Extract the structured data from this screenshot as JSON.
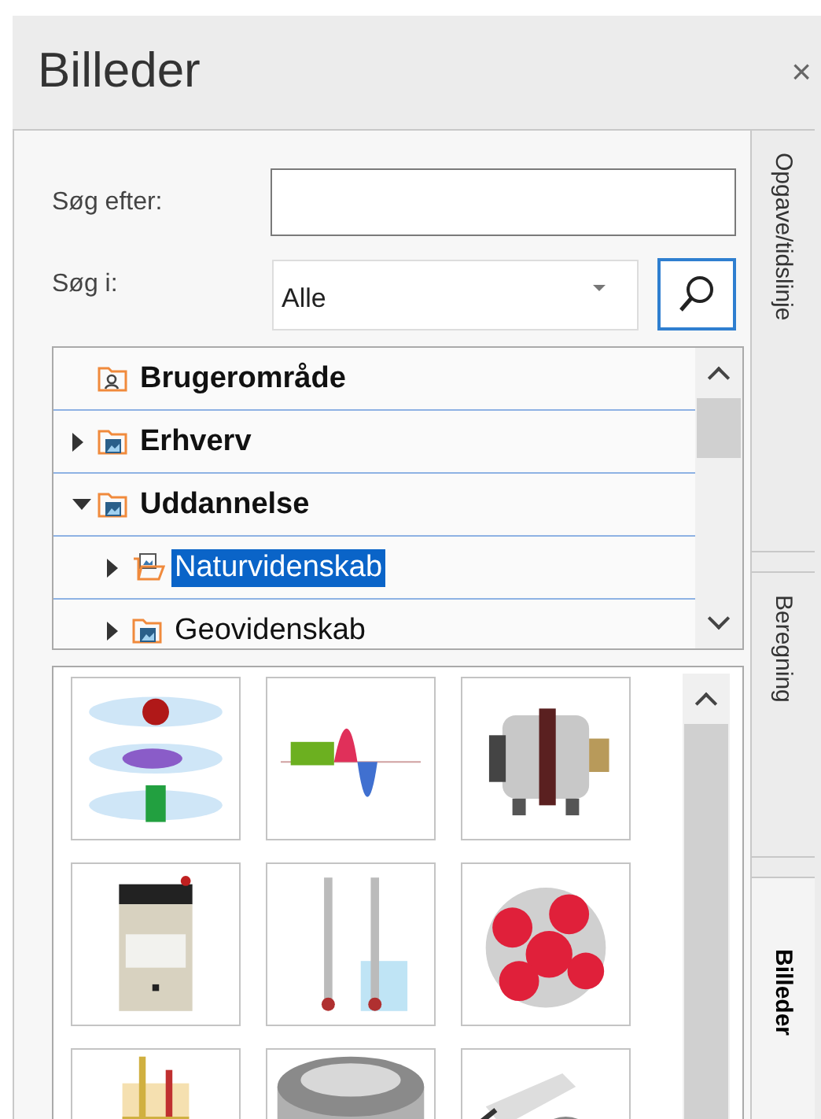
{
  "panel": {
    "title": "Billeder",
    "close": "×"
  },
  "search": {
    "query_label": "Søg efter:",
    "scope_label": "Søg i:",
    "scope_value": "Alle"
  },
  "tree": [
    {
      "label": "Brugerområde",
      "kind": "user-folder",
      "selected": false
    },
    {
      "label": "Erhverv",
      "kind": "picture-folder",
      "expanded": false,
      "selected": false
    },
    {
      "label": "Uddannelse",
      "kind": "picture-folder",
      "expanded": true,
      "selected": false,
      "children": [
        {
          "label": "Naturvidenskab",
          "kind": "picture-folder",
          "expanded": false,
          "selected": true
        },
        {
          "label": "Geovidenskab",
          "kind": "picture-folder",
          "expanded": false,
          "selected": false
        }
      ]
    }
  ],
  "side_tabs": [
    {
      "label": "Opgave/tidslinje",
      "selected": false
    },
    {
      "label": "Beregning",
      "selected": false
    },
    {
      "label": "Billeder",
      "selected": true
    }
  ]
}
